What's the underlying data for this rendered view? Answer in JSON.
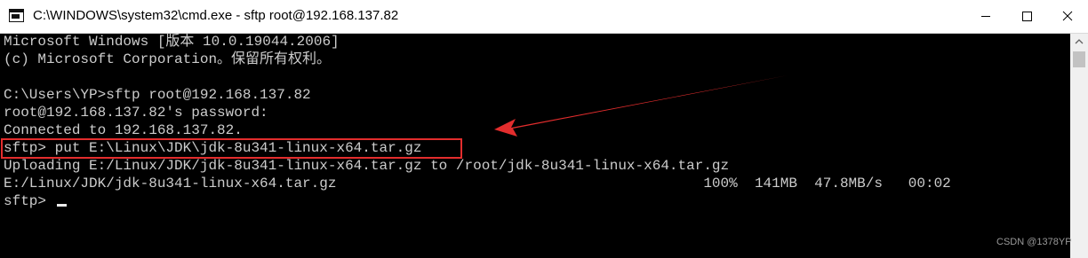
{
  "window": {
    "title": "C:\\WINDOWS\\system32\\cmd.exe - sftp  root@192.168.137.82",
    "icon": "cmd-icon",
    "controls": [
      "minimize-icon",
      "maximize-icon",
      "close-icon"
    ]
  },
  "console": {
    "lines": [
      "Microsoft Windows [版本 10.0.19044.2006]",
      "(c) Microsoft Corporation。保留所有权利。",
      "",
      "C:\\Users\\YP>sftp root@192.168.137.82",
      "root@192.168.137.82's password:",
      "Connected to 192.168.137.82.",
      "sftp> put E:\\Linux\\JDK\\jdk-8u341-linux-x64.tar.gz",
      "Uploading E:/Linux/JDK/jdk-8u341-linux-x64.tar.gz to /root/jdk-8u341-linux-x64.tar.gz",
      "E:/Linux/JDK/jdk-8u341-linux-x64.tar.gz                                           100%  141MB  47.8MB/s   00:02",
      "sftp> "
    ]
  },
  "annotation": {
    "highlight_color": "#e32d2d",
    "highlighted_line": 6
  },
  "watermark": "CSDN @1378YP"
}
